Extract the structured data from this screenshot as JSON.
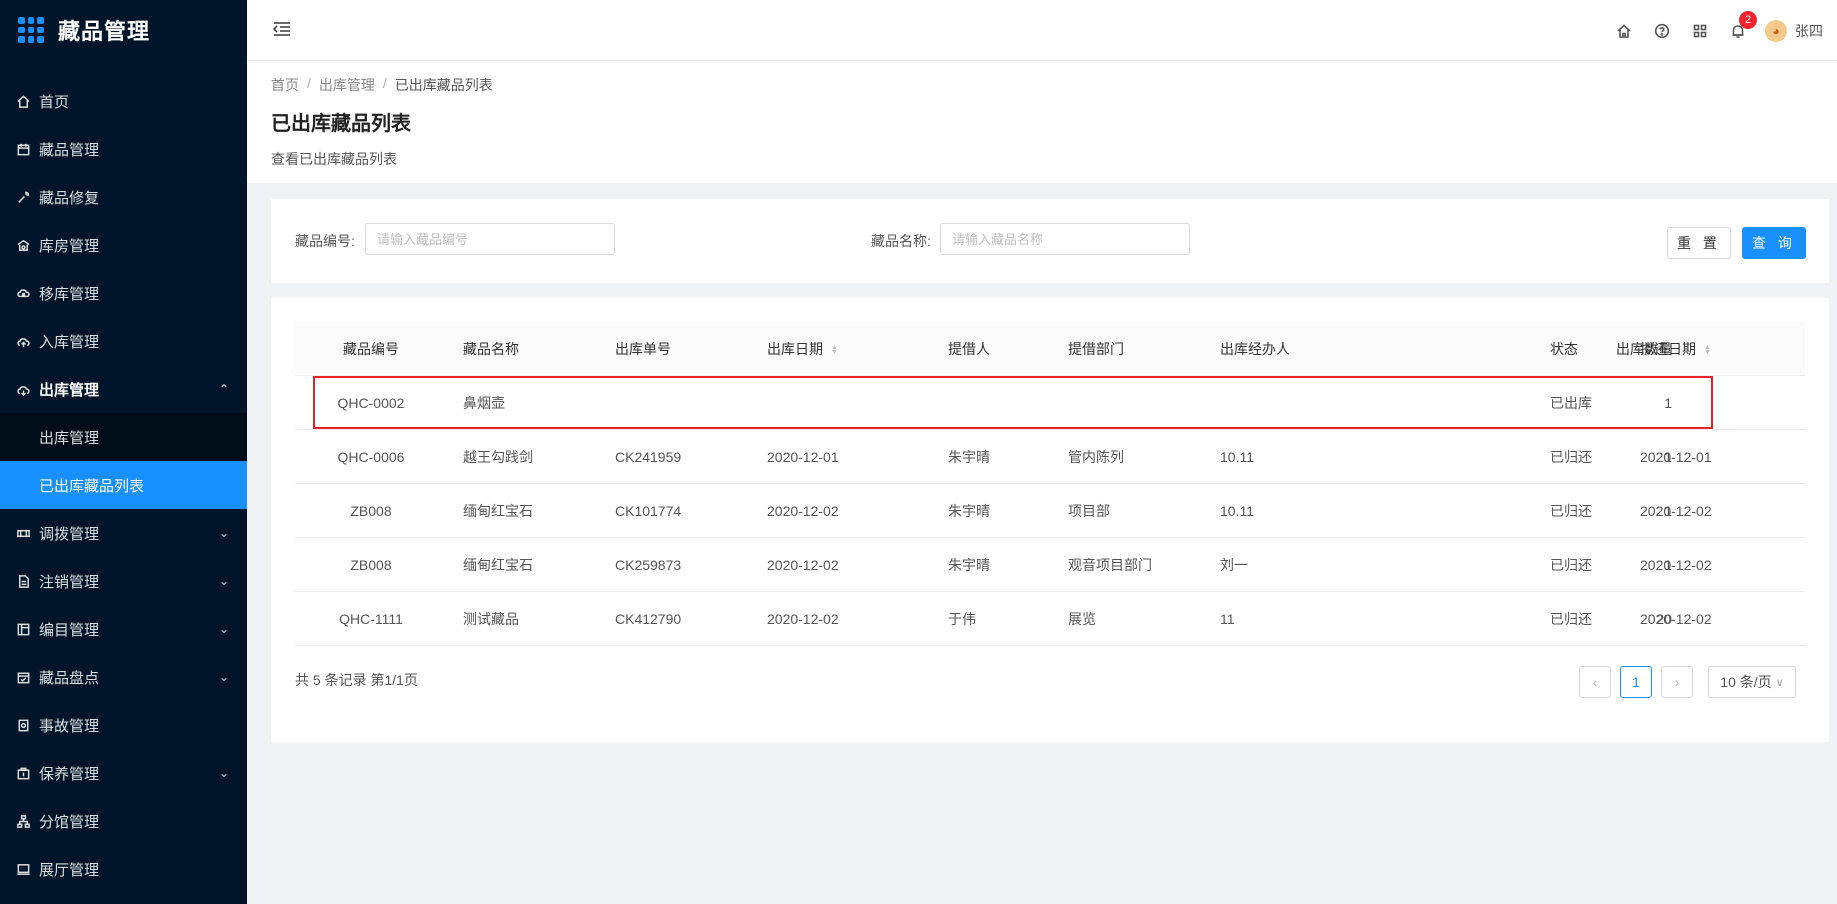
{
  "app": {
    "title": "藏品管理"
  },
  "sidebar": {
    "items": [
      {
        "label": "首页",
        "icon": "home-icon"
      },
      {
        "label": "藏品管理",
        "icon": "calendar-icon"
      },
      {
        "label": "藏品修复",
        "icon": "wrench-icon"
      },
      {
        "label": "库房管理",
        "icon": "warehouse-icon"
      },
      {
        "label": "移库管理",
        "icon": "move-icon"
      },
      {
        "label": "入库管理",
        "icon": "cloud-upload-icon"
      },
      {
        "label": "出库管理",
        "icon": "cloud-download-icon",
        "expanded": true
      },
      {
        "label": "调拨管理",
        "icon": "transfer-icon"
      },
      {
        "label": "注销管理",
        "icon": "file-icon"
      },
      {
        "label": "编目管理",
        "icon": "catalog-icon"
      },
      {
        "label": "藏品盘点",
        "icon": "inventory-icon"
      },
      {
        "label": "事故管理",
        "icon": "accident-icon"
      },
      {
        "label": "保养管理",
        "icon": "maintenance-icon"
      },
      {
        "label": "分馆管理",
        "icon": "branch-icon"
      },
      {
        "label": "展厅管理",
        "icon": "hall-icon"
      }
    ],
    "submenu": [
      {
        "label": "出库管理",
        "active": false
      },
      {
        "label": "已出库藏品列表",
        "active": true
      }
    ],
    "colors": {
      "bg": "#001529",
      "active": "#1890ff"
    }
  },
  "header": {
    "notification_count": "2",
    "username": "张四"
  },
  "breadcrumb": [
    "首页",
    "出库管理",
    "已出库藏品列表"
  ],
  "page": {
    "title": "已出库藏品列表",
    "description": "查看已出库藏品列表"
  },
  "search": {
    "code_label": "藏品编号:",
    "code_placeholder": "请输入藏品编号",
    "name_label": "藏品名称:",
    "name_placeholder": "请输入藏品名称",
    "reset_label": "重 置",
    "query_label": "查 询"
  },
  "table": {
    "columns": [
      "藏品编号",
      "藏品名称",
      "出库单号",
      "出库日期",
      "提借人",
      "提借部门",
      "出库经办人",
      "出库数量",
      "状态",
      "拟还日期"
    ],
    "rows": [
      [
        "QHC-0002",
        "鼻烟壶",
        "",
        "",
        "",
        "",
        "",
        "1",
        "已出库",
        ""
      ],
      [
        "QHC-0006",
        "越王勾践剑",
        "CK241959",
        "2020-12-01",
        "朱宇晴",
        "管内陈列",
        "10.11",
        "1",
        "已归还",
        "2020-12-01"
      ],
      [
        "ZB008",
        "缅甸红宝石",
        "CK101774",
        "2020-12-02",
        "朱宇晴",
        "项目部",
        "10.11",
        "1",
        "已归还",
        "2020-12-02"
      ],
      [
        "ZB008",
        "缅甸红宝石",
        "CK259873",
        "2020-12-02",
        "朱宇晴",
        "观音项目部门",
        "刘一",
        "1",
        "已归还",
        "2020-12-02"
      ],
      [
        "QHC-1111",
        "测试藏品",
        "CK412790",
        "2020-12-02",
        "于伟",
        "展览",
        "11",
        "20",
        "已归还",
        "2020-12-02"
      ]
    ]
  },
  "pagination": {
    "total_text": "共 5 条记录 第1/1页",
    "current_page": "1",
    "page_size": "10 条/页"
  }
}
